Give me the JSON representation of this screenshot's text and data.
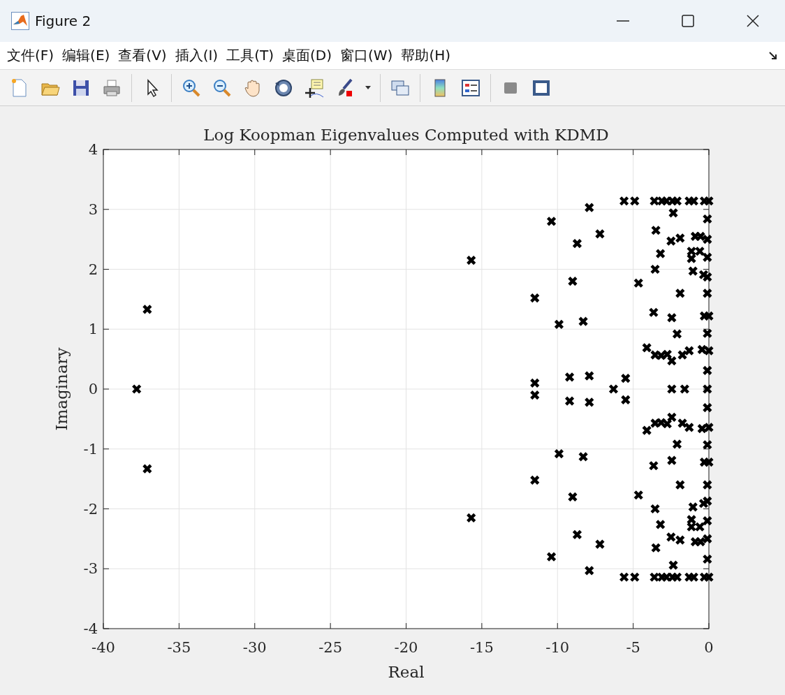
{
  "window": {
    "title": "Figure 2"
  },
  "menu": [
    {
      "label": "文件(F)"
    },
    {
      "label": "编辑(E)"
    },
    {
      "label": "查看(V)"
    },
    {
      "label": "插入(I)"
    },
    {
      "label": "工具(T)"
    },
    {
      "label": "桌面(D)"
    },
    {
      "label": "窗口(W)"
    },
    {
      "label": "帮助(H)"
    }
  ],
  "plot": {
    "chart_data": {
      "type": "scatter",
      "title": "Log Koopman Eigenvalues Computed with KDMD",
      "xlabel": "Real",
      "ylabel": "Imaginary",
      "xlim": [
        -40,
        0
      ],
      "ylim": [
        -4,
        4
      ],
      "xticks": [
        -40,
        -35,
        -30,
        -25,
        -20,
        -15,
        -10,
        -5,
        0
      ],
      "yticks": [
        -4,
        -3,
        -2,
        -1,
        0,
        1,
        2,
        3,
        4
      ],
      "grid": true,
      "x": [
        -37.8,
        -6.3,
        -2.45,
        -1.6,
        -0.1,
        -37.1,
        -15.7,
        -10.4,
        -7.9,
        -7.2,
        -8.7,
        -9.0,
        -11.5,
        -9.9,
        -8.3,
        -11.5,
        -9.2,
        -7.9,
        -5.5,
        -5.6,
        -4.9,
        -3.6,
        -3.1,
        -2.8,
        -2.4,
        -2.1,
        -1.3,
        -1.0,
        -0.3,
        0,
        -2.35,
        -0.1,
        -3.5,
        -2.5,
        -1.9,
        -0.9,
        -0.55,
        -0.1,
        -3.2,
        -1.15,
        -0.6,
        -1.15,
        -0.1,
        -3.55,
        -1.05,
        -0.35,
        -0.1,
        -4.65,
        -1.9,
        -0.1,
        -3.65,
        -2.45,
        -0.3,
        0,
        -2.1,
        -0.1,
        -4.1,
        -3.55,
        -3.15,
        -2.75,
        -2.45,
        -1.75,
        -1.3,
        -0.45,
        0,
        -0.1,
        -37.1,
        -15.7,
        -10.4,
        -7.9,
        -7.2,
        -8.7,
        -9.0,
        -11.5,
        -9.9,
        -8.3,
        -11.5,
        -9.2,
        -7.9,
        -5.5,
        -5.6,
        -4.9,
        -3.6,
        -3.1,
        -2.8,
        -2.4,
        -2.1,
        -1.3,
        -1.0,
        -0.3,
        0,
        -2.35,
        -0.1,
        -3.5,
        -2.5,
        -1.9,
        -0.9,
        -0.55,
        -0.1,
        -3.2,
        -1.15,
        -0.6,
        -1.15,
        -0.1,
        -3.55,
        -1.05,
        -0.35,
        -0.1,
        -4.65,
        -1.9,
        -0.1,
        -3.65,
        -2.45,
        -0.3,
        0,
        -2.1,
        -0.1,
        -4.1,
        -3.55,
        -3.15,
        -2.75,
        -2.45,
        -1.75,
        -1.3,
        -0.45,
        0,
        -0.1
      ],
      "series": [
        {
          "color": "#000000",
          "values": [
            0,
            0,
            0,
            0,
            0,
            1.33,
            2.15,
            2.8,
            3.03,
            2.59,
            2.43,
            1.8,
            1.52,
            1.08,
            1.13,
            0.1,
            0.2,
            0.22,
            0.18,
            3.14,
            3.14,
            3.14,
            3.14,
            3.14,
            3.14,
            3.14,
            3.14,
            3.14,
            3.14,
            3.14,
            2.94,
            2.84,
            2.65,
            2.47,
            2.52,
            2.55,
            2.55,
            2.5,
            2.26,
            2.3,
            2.3,
            2.18,
            2.2,
            2.0,
            1.97,
            1.91,
            1.87,
            1.77,
            1.6,
            1.6,
            1.28,
            1.19,
            1.22,
            1.22,
            0.92,
            0.93,
            0.69,
            0.57,
            0.56,
            0.58,
            0.47,
            0.57,
            0.64,
            0.66,
            0.64,
            0.31,
            -1.33,
            -2.15,
            -2.8,
            -3.03,
            -2.59,
            -2.43,
            -1.8,
            -1.52,
            -1.08,
            -1.13,
            -0.1,
            -0.2,
            -0.22,
            -0.18,
            -3.14,
            -3.14,
            -3.14,
            -3.14,
            -3.14,
            -3.14,
            -3.14,
            -3.14,
            -3.14,
            -3.14,
            -3.14,
            -2.94,
            -2.84,
            -2.65,
            -2.47,
            -2.52,
            -2.55,
            -2.55,
            -2.5,
            -2.26,
            -2.3,
            -2.3,
            -2.18,
            -2.2,
            -2.0,
            -1.97,
            -1.91,
            -1.87,
            -1.77,
            -1.6,
            -1.6,
            -1.28,
            -1.19,
            -1.22,
            -1.22,
            -0.92,
            -0.93,
            -0.69,
            -0.57,
            -0.56,
            -0.58,
            -0.47,
            -0.57,
            -0.64,
            -0.66,
            -0.64,
            -0.31
          ]
        }
      ]
    }
  }
}
